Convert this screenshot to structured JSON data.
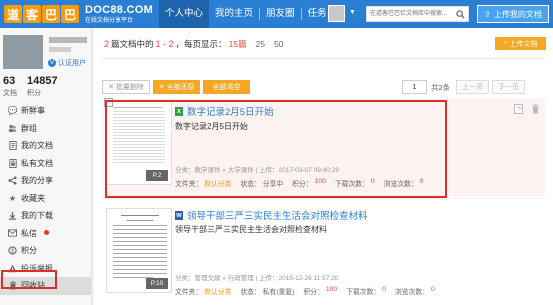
{
  "header": {
    "logo_chars": [
      "道",
      "客",
      "巴",
      "巴"
    ],
    "logo_name": "DOC88.COM",
    "logo_slogan": "在线文档分享平台",
    "nav": [
      {
        "label": "个人中心",
        "active": true
      },
      {
        "label": "我的主页",
        "active": false
      },
      {
        "label": "朋友圈",
        "active": false
      },
      {
        "label": "任务",
        "active": false
      }
    ],
    "search_placeholder": "在道客巴巴亿文档库中搜索...",
    "upload_label": "上传我的文档"
  },
  "sidebar": {
    "verify_label": "认证用户",
    "stats": [
      {
        "num": "63",
        "label": "文档"
      },
      {
        "num": "14857",
        "label": "积分"
      }
    ],
    "items": [
      {
        "label": "新鲜事",
        "icon": "comment-icon"
      },
      {
        "label": "群组",
        "icon": "group-icon"
      },
      {
        "label": "我的文档",
        "icon": "document-icon"
      },
      {
        "label": "私有文档",
        "icon": "lock-document-icon"
      },
      {
        "label": "我的分享",
        "icon": "share-icon"
      },
      {
        "label": "收藏夹",
        "icon": "star-icon"
      },
      {
        "label": "我的下载",
        "icon": "download-icon"
      },
      {
        "label": "私信",
        "icon": "mail-icon"
      },
      {
        "label": "积分",
        "icon": "coin-icon"
      },
      {
        "label": "投诉举报",
        "icon": "report-icon"
      },
      {
        "label": "回收站",
        "icon": "trash-icon"
      }
    ]
  },
  "main": {
    "summary": {
      "count": "2",
      "pre": "篇文档中的",
      "range": "1 - 2",
      "mid": "，每页显示：",
      "per_page_options": [
        "15篇",
        "25",
        "50"
      ]
    },
    "top_upload_label": "上传文档",
    "toolbar": {
      "delete_label": "批量删除",
      "restore_label": "全部还原",
      "delete_all_label": "全部清空"
    },
    "pager": {
      "current": "1",
      "total": "共2条",
      "prev": "上一页",
      "next": "下一页"
    },
    "docs": [
      {
        "title": "数字记录2月5日开始",
        "desc": "数字记录2月5日开始",
        "meta": "分类：教学课件 » 大学课件 | 上传：2017-03-07 09:40:29",
        "pages": "P.2",
        "file_type": "excel",
        "stats": [
          {
            "k": "文件夹：",
            "v": "默认分类",
            "c": "vo"
          },
          {
            "k": "状态：",
            "v": "分享中",
            "c": ""
          },
          {
            "k": "积分：",
            "v": "100",
            "c": "vr"
          },
          {
            "k": "下载次数：",
            "v": "0",
            "c": "vr"
          },
          {
            "k": "浏览次数：",
            "v": "0",
            "c": "vr"
          }
        ]
      },
      {
        "title": "领导干部三严三实民主生活会对照检查材料",
        "desc": "领导干部三严三实民主生活会对照检查材料",
        "meta": "分类：管理文献 » 行政管理 | 上传：2015-12-26 11:57:20",
        "pages": "P.10",
        "file_type": "word",
        "stats": [
          {
            "k": "文件夹：",
            "v": "默认分类",
            "c": "vo"
          },
          {
            "k": "状态：",
            "v": "私有(重复)",
            "c": ""
          },
          {
            "k": "积分：",
            "v": "100",
            "c": "vr"
          },
          {
            "k": "下载次数：",
            "v": "0",
            "c": "vr"
          },
          {
            "k": "浏览次数：",
            "v": "0",
            "c": "vr"
          }
        ]
      }
    ]
  },
  "colors": {
    "brand_blue": "#2a7fd4",
    "orange": "#f5a623",
    "highlight_red": "#d9302b"
  }
}
